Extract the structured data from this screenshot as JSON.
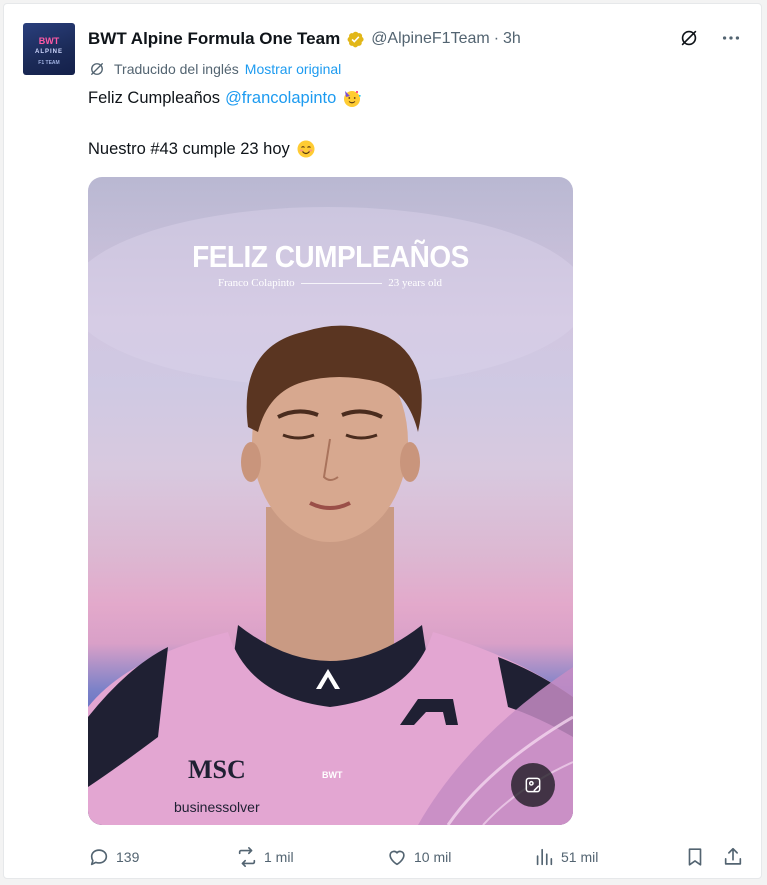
{
  "tweet": {
    "author_name": "BWT Alpine Formula One Team",
    "handle": "@AlpineF1Team",
    "separator": "·",
    "time": "3h",
    "translation_note": "Traducido del inglés",
    "show_original_label": "Mostrar original",
    "text_line1": "Feliz Cumpleaños",
    "mention": "@francolapinto",
    "text_line2": "Nuestro #43 cumple 23 hoy",
    "emoji1": "party-face-emoji",
    "emoji2": "smiling-face-emoji"
  },
  "avatar": {
    "line1": "BWT",
    "line2": "ALPINE",
    "line3": "F1 TEAM"
  },
  "media": {
    "title": "FELIZ CUMPLEAÑOS",
    "subtitle_left": "Franco Colapinto",
    "subtitle_right": "23 years old",
    "suit_sponsor1": "MSC",
    "suit_sponsor2": "businessolver",
    "suit_brand": "BWT"
  },
  "actions": {
    "replies": "139",
    "reposts": "1 mil",
    "likes": "10 mil",
    "views": "51 mil"
  },
  "icons": {
    "verified": "verified-badge-icon",
    "grok": "grok-icon",
    "more": "more-icon",
    "reply": "reply-icon",
    "repost": "repost-icon",
    "like": "like-icon",
    "views": "views-icon",
    "bookmark": "bookmark-icon",
    "share": "share-icon"
  },
  "colors": {
    "link": "#1d9bf0",
    "muted": "#536471",
    "verified_gold": "#e2b719"
  }
}
